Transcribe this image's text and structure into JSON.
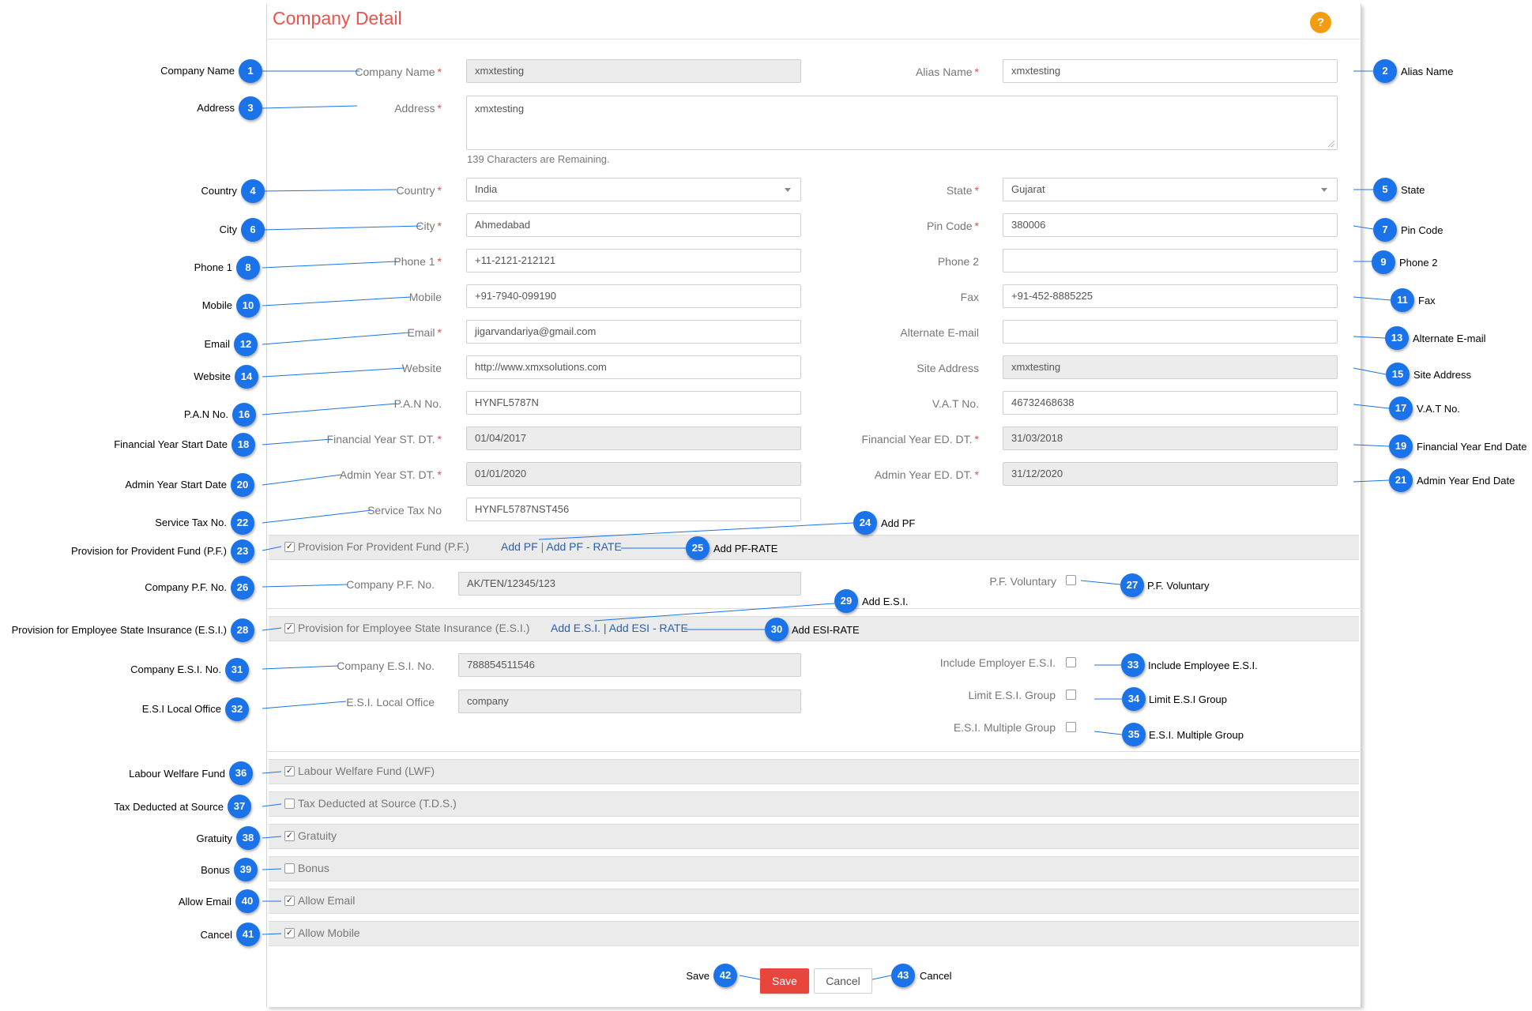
{
  "page": {
    "title": "Company Detail",
    "help_icon": "help-icon",
    "help_symbol": "?",
    "colors": {
      "title": "#e9544f",
      "badge": "#1a73e8",
      "save": "#e8453c",
      "help": "#f39c12"
    }
  },
  "form": {
    "company_name": {
      "label": "Company Name",
      "value": "xmxtesting"
    },
    "alias_name": {
      "label": "Alias Name",
      "value": "xmxtesting"
    },
    "address": {
      "label": "Address",
      "value": "xmxtesting",
      "hint": "139 Characters are Remaining."
    },
    "country": {
      "label": "Country",
      "value": "India"
    },
    "state": {
      "label": "State",
      "value": "Gujarat"
    },
    "city": {
      "label": "City",
      "value": "Ahmedabad"
    },
    "pin_code": {
      "label": "Pin Code",
      "value": "380006"
    },
    "phone1": {
      "label": "Phone 1",
      "value": "+11-2121-212121"
    },
    "phone2": {
      "label": "Phone 2",
      "value": ""
    },
    "mobile": {
      "label": "Mobile",
      "value": "+91-7940-099190"
    },
    "fax": {
      "label": "Fax",
      "value": "+91-452-8885225"
    },
    "email": {
      "label": "Email",
      "value": "jigarvandariya@gmail.com"
    },
    "alt_email": {
      "label": "Alternate E-mail",
      "value": ""
    },
    "website": {
      "label": "Website",
      "value": "http://www.xmxsolutions.com"
    },
    "site_address": {
      "label": "Site Address",
      "value": "xmxtesting"
    },
    "pan": {
      "label": "P.A.N No.",
      "value": "HYNFL5787N"
    },
    "vat": {
      "label": "V.A.T No.",
      "value": "46732468638"
    },
    "fy_start": {
      "label": "Financial Year ST. DT.",
      "value": "01/04/2017"
    },
    "fy_end": {
      "label": "Financial Year ED. DT.",
      "value": "31/03/2018"
    },
    "admin_start": {
      "label": "Admin Year ST. DT.",
      "value": "01/01/2020"
    },
    "admin_end": {
      "label": "Admin Year ED. DT.",
      "value": "31/12/2020"
    },
    "service_tax": {
      "label": "Service Tax No",
      "value": "HYNFL5787NST456"
    }
  },
  "pf": {
    "label": "Provision For Provident Fund (P.F.)",
    "checked": true,
    "link_add": "Add PF",
    "link_sep": " | ",
    "link_rate": "Add PF - RATE",
    "company_pf": {
      "label": "Company P.F. No.",
      "value": "AK/TEN/12345/123"
    },
    "voluntary": {
      "label": "P.F. Voluntary",
      "checked": false
    }
  },
  "esi": {
    "label": "Provision for Employee State Insurance (E.S.I.)",
    "checked": true,
    "link_add": "Add E.S.I.",
    "link_sep": " | ",
    "link_rate": "Add ESI - RATE",
    "company_esi": {
      "label": "Company E.S.I. No.",
      "value": "788854511546"
    },
    "local_office": {
      "label": "E.S.I. Local Office",
      "value": "company"
    },
    "include_employer": {
      "label": "Include Employer E.S.I.",
      "checked": false
    },
    "limit_group": {
      "label": "Limit E.S.I. Group",
      "checked": false
    },
    "multiple_group": {
      "label": "E.S.I. Multiple Group",
      "checked": false
    }
  },
  "sections": [
    {
      "label": "Labour Welfare Fund (LWF)",
      "checked": true
    },
    {
      "label": "Tax Deducted at Source (T.D.S.)",
      "checked": false
    },
    {
      "label": "Gratuity",
      "checked": true
    },
    {
      "label": "Bonus",
      "checked": false
    },
    {
      "label": "Allow Email",
      "checked": true
    },
    {
      "label": "Allow Mobile",
      "checked": true
    }
  ],
  "buttons": {
    "save": "Save",
    "cancel": "Cancel"
  },
  "callouts": [
    {
      "n": "1",
      "text": "Company Name"
    },
    {
      "n": "2",
      "text": "Alias Name"
    },
    {
      "n": "3",
      "text": "Address"
    },
    {
      "n": "4",
      "text": "Country"
    },
    {
      "n": "5",
      "text": "State"
    },
    {
      "n": "6",
      "text": "City"
    },
    {
      "n": "7",
      "text": "Pin Code"
    },
    {
      "n": "8",
      "text": "Phone 1"
    },
    {
      "n": "9",
      "text": "Phone 2"
    },
    {
      "n": "10",
      "text": "Mobile"
    },
    {
      "n": "11",
      "text": "Fax"
    },
    {
      "n": "12",
      "text": "Email"
    },
    {
      "n": "13",
      "text": "Alternate E-mail"
    },
    {
      "n": "14",
      "text": "Website"
    },
    {
      "n": "15",
      "text": "Site Address"
    },
    {
      "n": "16",
      "text": "P.A.N No."
    },
    {
      "n": "17",
      "text": "V.A.T No."
    },
    {
      "n": "18",
      "text": "Financial Year Start Date"
    },
    {
      "n": "19",
      "text": "Financial Year End Date"
    },
    {
      "n": "20",
      "text": "Admin Year Start Date"
    },
    {
      "n": "21",
      "text": "Admin Year End Date"
    },
    {
      "n": "22",
      "text": "Service Tax No."
    },
    {
      "n": "23",
      "text": "Provision for Provident Fund (P.F.)"
    },
    {
      "n": "24",
      "text": "Add PF"
    },
    {
      "n": "25",
      "text": "Add PF-RATE"
    },
    {
      "n": "26",
      "text": "Company P.F. No."
    },
    {
      "n": "27",
      "text": "P.F. Voluntary"
    },
    {
      "n": "28",
      "text": "Provision for Employee State Insurance (E.S.I.)"
    },
    {
      "n": "29",
      "text": "Add E.S.I."
    },
    {
      "n": "30",
      "text": "Add ESI-RATE"
    },
    {
      "n": "31",
      "text": "Company E.S.I. No."
    },
    {
      "n": "32",
      "text": "E.S.I Local Office"
    },
    {
      "n": "33",
      "text": "Include Employee E.S.I."
    },
    {
      "n": "34",
      "text": "Limit E.S.I Group"
    },
    {
      "n": "35",
      "text": "E.S.I. Multiple Group"
    },
    {
      "n": "36",
      "text": "Labour Welfare Fund"
    },
    {
      "n": "37",
      "text": "Tax Deducted at Source"
    },
    {
      "n": "38",
      "text": "Gratuity"
    },
    {
      "n": "39",
      "text": "Bonus"
    },
    {
      "n": "40",
      "text": "Allow Email"
    },
    {
      "n": "41",
      "text": "Cancel"
    },
    {
      "n": "42",
      "text": "Save"
    },
    {
      "n": "43",
      "text": "Cancel"
    }
  ]
}
